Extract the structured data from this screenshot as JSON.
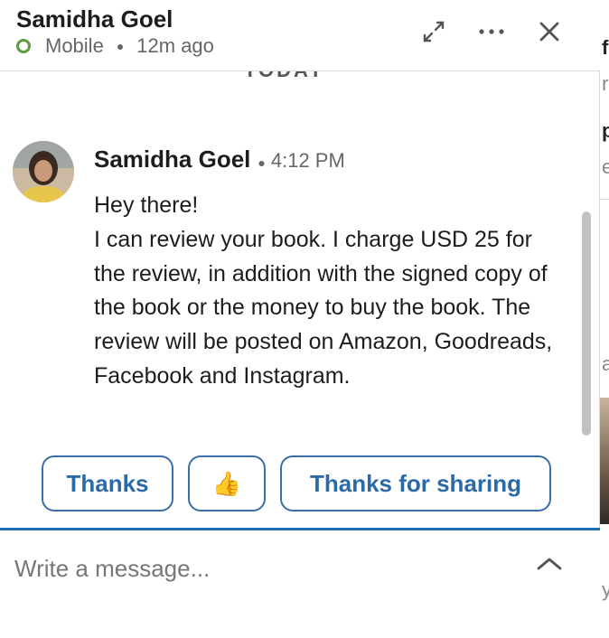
{
  "header": {
    "contact_name": "Samidha Goel",
    "status": "Mobile",
    "last_active": "12m ago",
    "actions": [
      "expand-icon",
      "more-icon",
      "close-icon"
    ]
  },
  "conversation": {
    "day_label": "TODAY",
    "message": {
      "sender": "Samidha Goel",
      "time": "4:12 PM",
      "lines": [
        "Hey there!",
        "I can review your book. I charge USD 25 for the review, in addition with the signed copy of the book or the money to buy the book. The review will be posted on Amazon, Goodreads, Facebook and Instagram."
      ]
    }
  },
  "quick_replies": {
    "thanks": "Thanks",
    "thumbs_up": "👍",
    "thanks_for_sharing": "Thanks for sharing"
  },
  "composer": {
    "placeholder": "Write a message..."
  },
  "colors": {
    "accent": "#1e6bb8",
    "button_text": "#2b6aa7",
    "presence_green": "#5f9b41"
  }
}
